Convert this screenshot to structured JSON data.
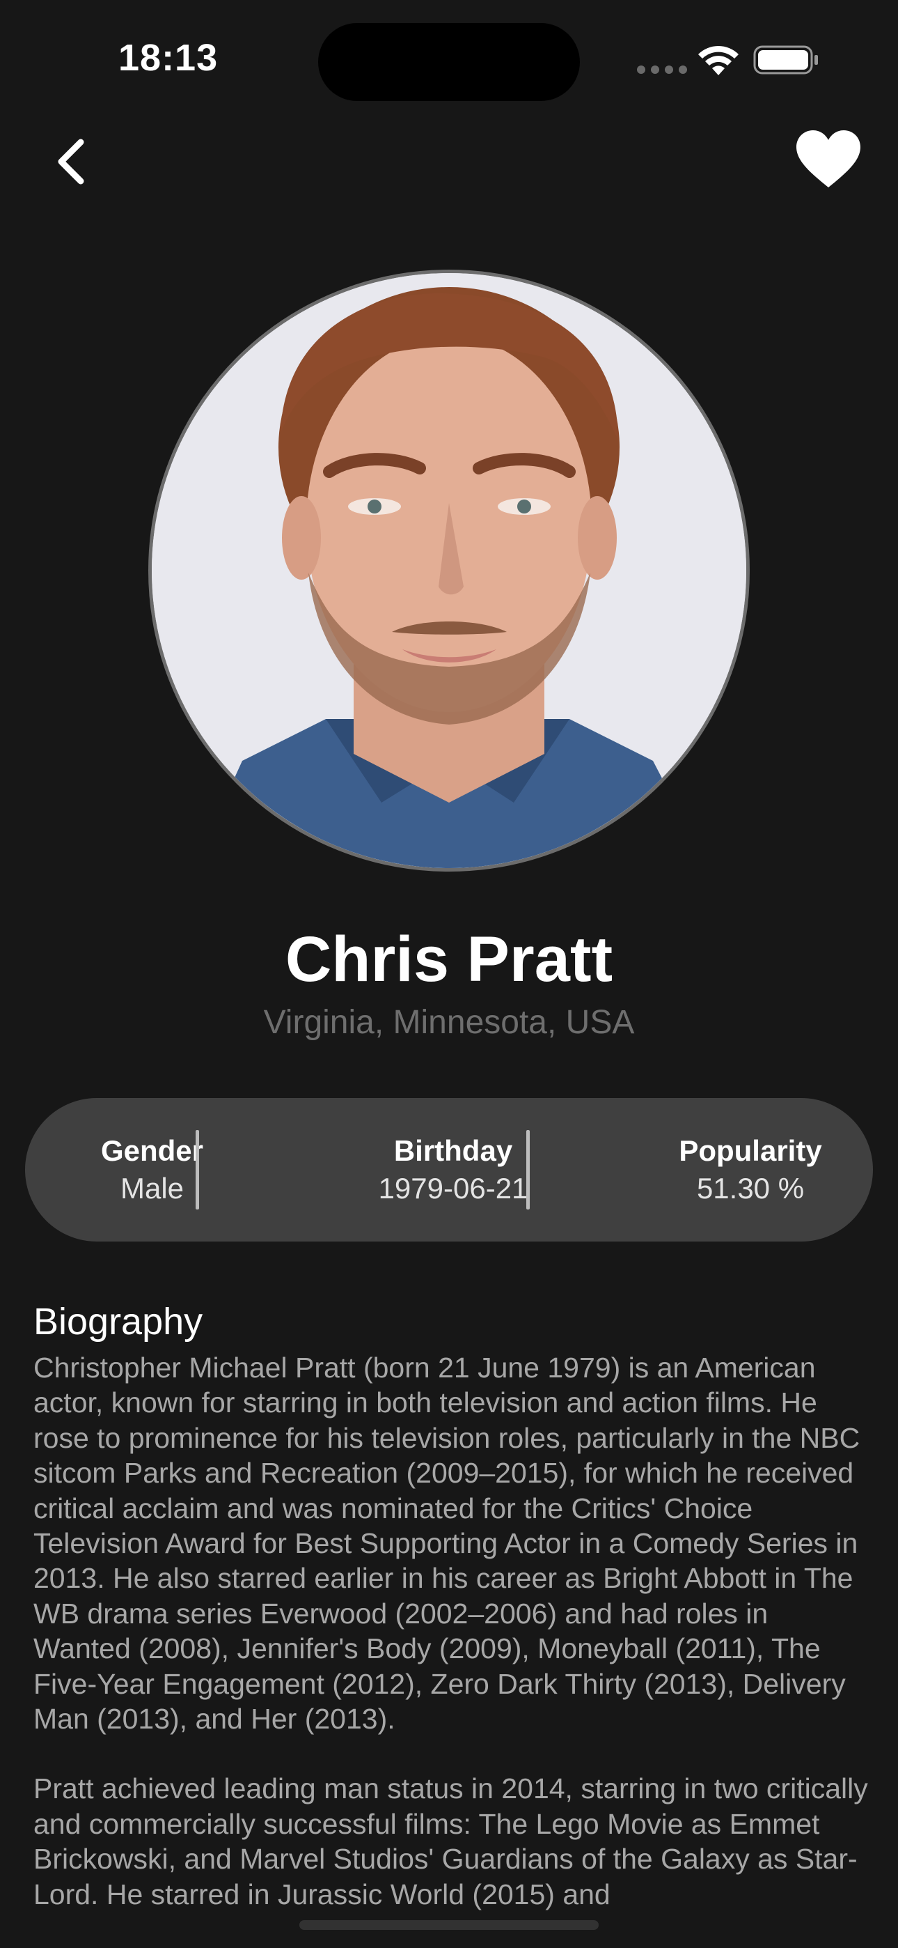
{
  "status_bar": {
    "time": "18:13"
  },
  "nav": {
    "back_icon": "chevron-left-icon",
    "favorite_icon": "heart-icon"
  },
  "person": {
    "name": "Chris Pratt",
    "birthplace": "Virginia, Minnesota, USA",
    "photo": "actor portrait photo"
  },
  "info": {
    "gender_label": "Gender",
    "gender_value": "Male",
    "birthday_label": "Birthday",
    "birthday_value": "1979-06-21",
    "popularity_label": "Popularity",
    "popularity_value": "51.30 %"
  },
  "biography": {
    "heading": "Biography",
    "paragraph_1": "Christopher Michael Pratt (born 21 June 1979) is an American actor, known for starring in both television and action films. He rose to prominence for his television roles, particularly in the NBC sitcom Parks and Recreation (2009–2015), for which he received critical acclaim and was nominated for the Critics' Choice Television Award for Best Supporting Actor in a Comedy Series in 2013. He also starred earlier in his career as Bright Abbott in The WB drama series Everwood (2002–2006) and had roles in Wanted (2008), Jennifer's Body (2009), Moneyball (2011), The Five-Year Engagement (2012), Zero Dark Thirty (2013), Delivery Man (2013), and Her (2013).",
    "paragraph_2": "Pratt achieved leading man status in 2014, starring in two critically and commercially successful films: The Lego Movie as Emmet Brickowski, and Marvel Studios' Guardians of the Galaxy as Star-Lord. He starred in Jurassic World (2015) and"
  },
  "colors": {
    "background": "#171717",
    "pill": "#404040",
    "muted_text": "#a7a7a7"
  }
}
